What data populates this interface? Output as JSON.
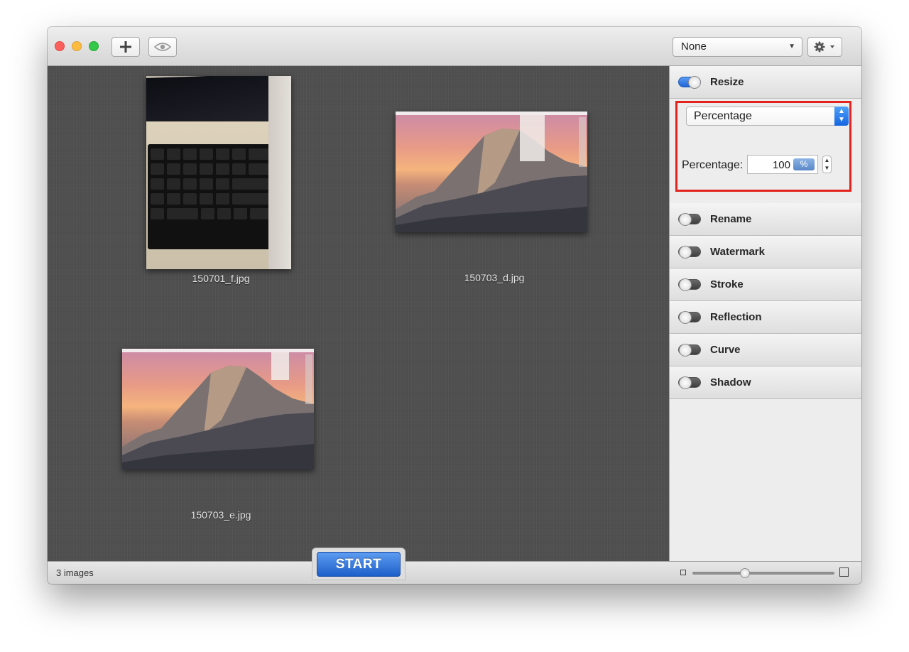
{
  "toolbar": {
    "add_button_icon": "plus-icon",
    "preview_button_icon": "eye-icon",
    "preset_select_value": "None",
    "settings_button_icon": "gear-icon"
  },
  "images": [
    {
      "name": "150701_f.jpg",
      "kind": "laptop-photo"
    },
    {
      "name": "150703_d.jpg",
      "kind": "yosemite-screenshot"
    },
    {
      "name": "150703_e.jpg",
      "kind": "yosemite-screenshot"
    }
  ],
  "panel": {
    "resize": {
      "label": "Resize",
      "enabled": true,
      "mode_value": "Percentage",
      "percentage_label": "Percentage:",
      "percentage_value": "100",
      "unit": "%"
    },
    "sections": [
      {
        "label": "Rename",
        "enabled": false
      },
      {
        "label": "Watermark",
        "enabled": false
      },
      {
        "label": "Stroke",
        "enabled": false
      },
      {
        "label": "Reflection",
        "enabled": false
      },
      {
        "label": "Curve",
        "enabled": false
      },
      {
        "label": "Shadow",
        "enabled": false
      }
    ]
  },
  "footer": {
    "count_text": "3 images",
    "start_label": "START",
    "zoom_level": 0.37
  },
  "colors": {
    "highlight_border": "#e4231f",
    "accent_blue": "#1f65d8"
  }
}
